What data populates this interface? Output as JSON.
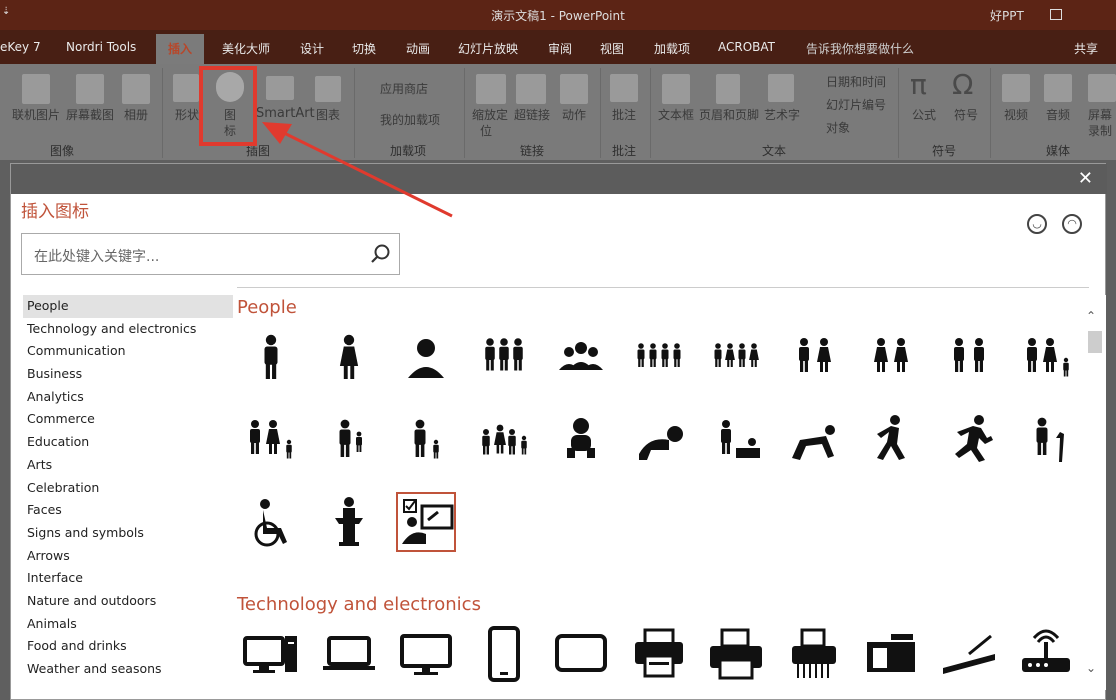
{
  "title_bar": {
    "doc_title": "演示文稿1  -  PowerPoint",
    "user": "好PPT"
  },
  "tabs": [
    "eKey 7",
    "Nordri Tools",
    "插入",
    "美化大师",
    "设计",
    "切换",
    "动画",
    "幻灯片放映",
    "审阅",
    "视图",
    "加载项",
    "ACROBAT"
  ],
  "active_tab": "插入",
  "tell_me": "告诉我你想要做什么",
  "share": "共享",
  "ribbon": {
    "b1": "联机图片",
    "b2": "屏幕截图",
    "b3": "相册",
    "b4": "形状",
    "b5": "图",
    "b5b": "标",
    "b6": "SmartArt",
    "b7": "图表",
    "b8": "应用商店",
    "b9": "我的加载项",
    "b10": "缩放定",
    "b10b": "位",
    "b11": "超链接",
    "b12": "动作",
    "b13": "批注",
    "b14": "文本框",
    "b15": "页眉和页脚",
    "b16": "艺术字",
    "b17": "日期和时间",
    "b18": "幻灯片编号",
    "b19": "对象",
    "b20": "公式",
    "b21": "符号",
    "b22": "视频",
    "b23": "音频",
    "b24": "屏幕",
    "b24b": "录制",
    "g1": "图像",
    "g2": "插图",
    "g3": "加载项",
    "g4": "链接",
    "g5": "批注",
    "g6": "文本",
    "g7": "符号",
    "g8": "媒体"
  },
  "dialog": {
    "title": "插入图标",
    "search_placeholder": "在此处键入关键字...",
    "categories": [
      "People",
      "Technology and electronics",
      "Communication",
      "Business",
      "Analytics",
      "Commerce",
      "Education",
      "Arts",
      "Celebration",
      "Faces",
      "Signs and symbols",
      "Arrows",
      "Interface",
      "Nature and outdoors",
      "Animals",
      "Food and drinks",
      "Weather and seasons"
    ],
    "selected_category": "People",
    "section1": "People",
    "section2": "Technology and electronics"
  },
  "colors": {
    "accent": "#c0533a",
    "highlight": "#e03a2e"
  }
}
